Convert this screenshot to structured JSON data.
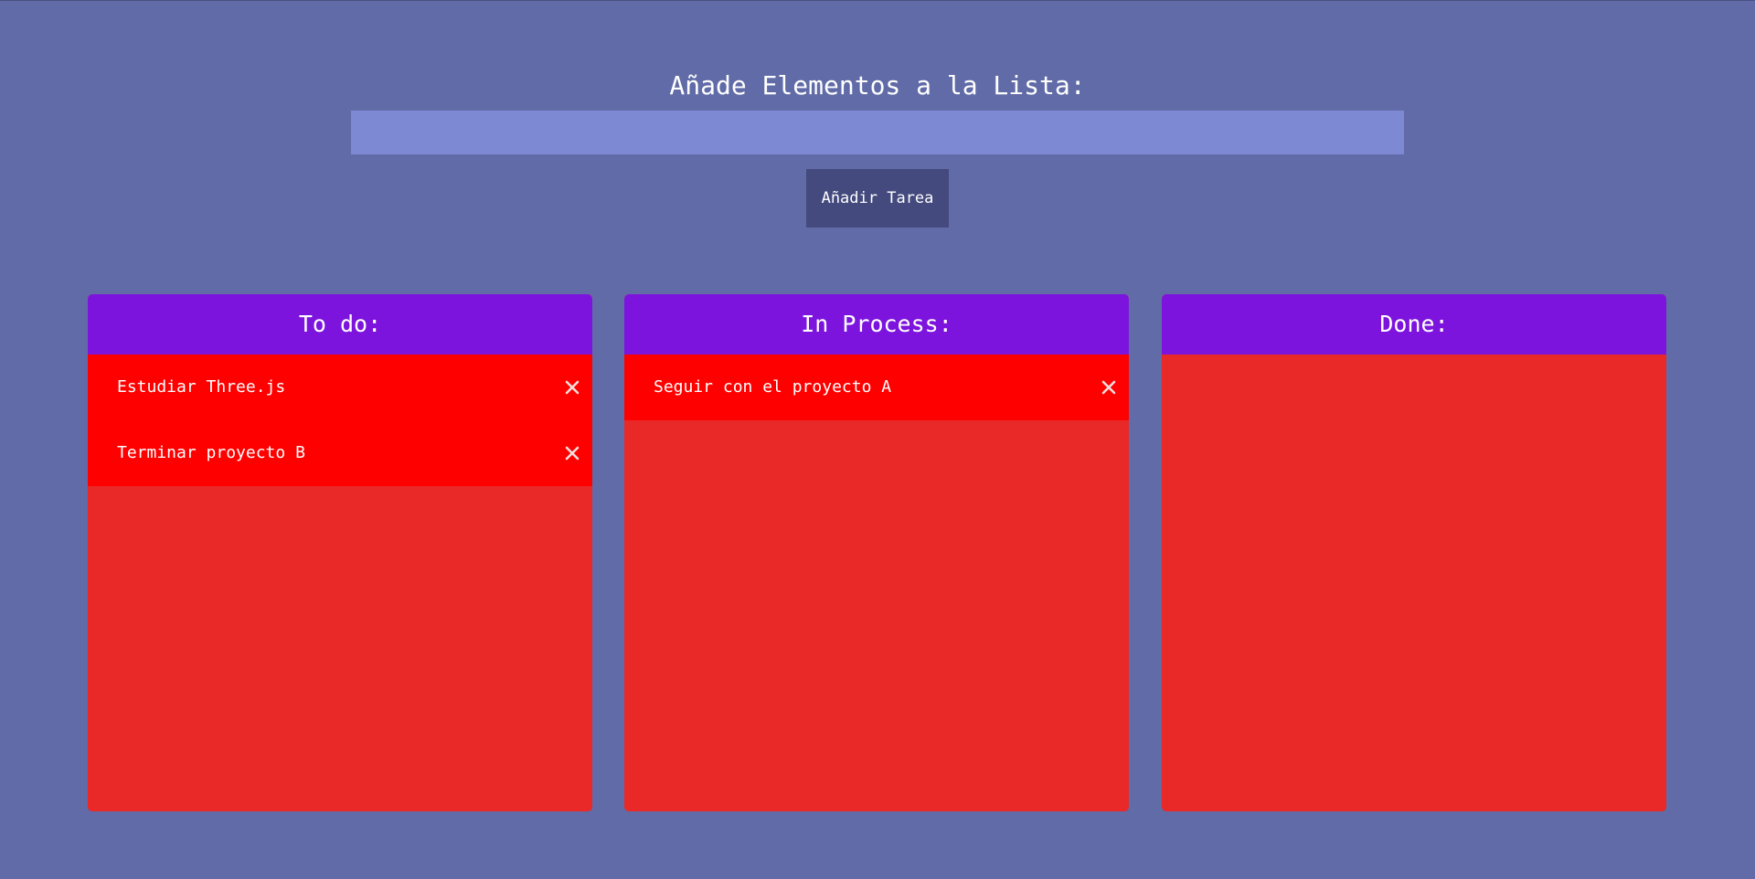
{
  "header": {
    "title": "Añade Elementos a la Lista:",
    "input_value": "",
    "input_placeholder": "",
    "add_button_label": "Añadir Tarea"
  },
  "columns": [
    {
      "title": "To do:",
      "tasks": [
        "Estudiar Three.js",
        "Terminar proyecto B"
      ]
    },
    {
      "title": "In Process:",
      "tasks": [
        "Seguir con el proyecto A"
      ]
    },
    {
      "title": "Done:",
      "tasks": []
    }
  ],
  "icons": {
    "delete": "close-icon"
  },
  "colors": {
    "background": "#606ba7",
    "input": "#7d89d3",
    "button": "#444a7d",
    "column_header": "#7d14de",
    "column_body": "#e92828",
    "task_item": "#ff0000"
  }
}
